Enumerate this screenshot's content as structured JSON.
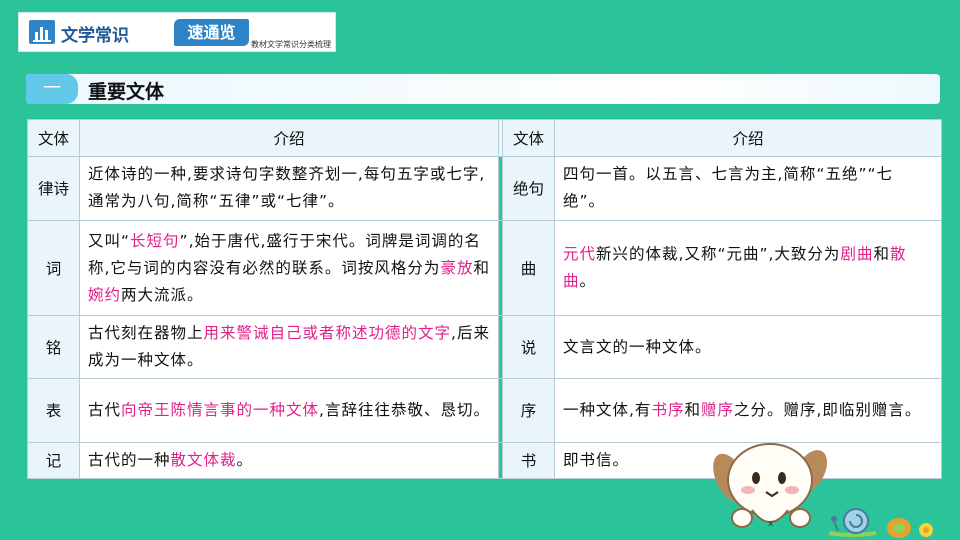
{
  "header": {
    "title": "文学常识",
    "tag": "速通览",
    "subtitle": "教材文学常识分类梳理"
  },
  "section": {
    "number": "一",
    "title": "重要文体"
  },
  "table": {
    "columns": [
      "文体",
      "介绍",
      "文体",
      "介绍"
    ],
    "rows": [
      {
        "left_name": "律诗",
        "left_desc": [
          {
            "t": "近体诗的一种,要求诗句字数整齐划一,每句五字或七字,通常为八句,简称“五律”或“七律”。"
          }
        ],
        "right_name": "绝句",
        "right_desc": [
          {
            "t": "四句一首。以五言、七言为主,简称“五绝”“七绝”。"
          }
        ]
      },
      {
        "left_name": "词",
        "left_desc": [
          {
            "t": "又叫“"
          },
          {
            "t": "长短句",
            "hl": true
          },
          {
            "t": "”,始于唐代,盛行于宋代。词牌是词调的名称,它与词的内容没有必然的联系。词按风格分为"
          },
          {
            "t": "豪放",
            "hl": true
          },
          {
            "t": "和"
          },
          {
            "t": "婉约",
            "hl": true
          },
          {
            "t": "两大流派。"
          }
        ],
        "right_name": "曲",
        "right_desc": [
          {
            "t": "元代",
            "hl": true
          },
          {
            "t": "新兴的体裁,又称“元曲”,大致分为"
          },
          {
            "t": "剧曲",
            "hl": true
          },
          {
            "t": "和"
          },
          {
            "t": "散曲",
            "hl": true
          },
          {
            "t": "。"
          }
        ]
      },
      {
        "left_name": "铭",
        "left_desc": [
          {
            "t": "古代刻在器物上"
          },
          {
            "t": "用来警诫自己或者称述功德的文字",
            "hl": true
          },
          {
            "t": ",后来成为一种文体。"
          }
        ],
        "right_name": "说",
        "right_desc": [
          {
            "t": "文言文的一种文体。"
          }
        ]
      },
      {
        "left_name": "表",
        "left_desc": [
          {
            "t": "古代"
          },
          {
            "t": "向帝王陈情言事的一种文体",
            "hl": true
          },
          {
            "t": ",言辞往往恭敬、恳切。"
          }
        ],
        "right_name": "序",
        "right_desc": [
          {
            "t": "一种文体,有"
          },
          {
            "t": "书序",
            "hl": true
          },
          {
            "t": "和"
          },
          {
            "t": "赠序",
            "hl": true
          },
          {
            "t": "之分。赠序,即临别赠言。"
          }
        ]
      },
      {
        "left_name": "记",
        "left_desc": [
          {
            "t": "古代的一种"
          },
          {
            "t": "散文体裁",
            "hl": true
          },
          {
            "t": "。"
          }
        ],
        "right_name": "书",
        "right_desc": [
          {
            "t": "即书信。"
          }
        ]
      }
    ]
  },
  "colors": {
    "background": "#2ac39a",
    "highlight": "#e0218a",
    "header_blue": "#2f84c7"
  },
  "icons": [
    "chart-icon",
    "puppy-mascot",
    "snail-decoration"
  ]
}
